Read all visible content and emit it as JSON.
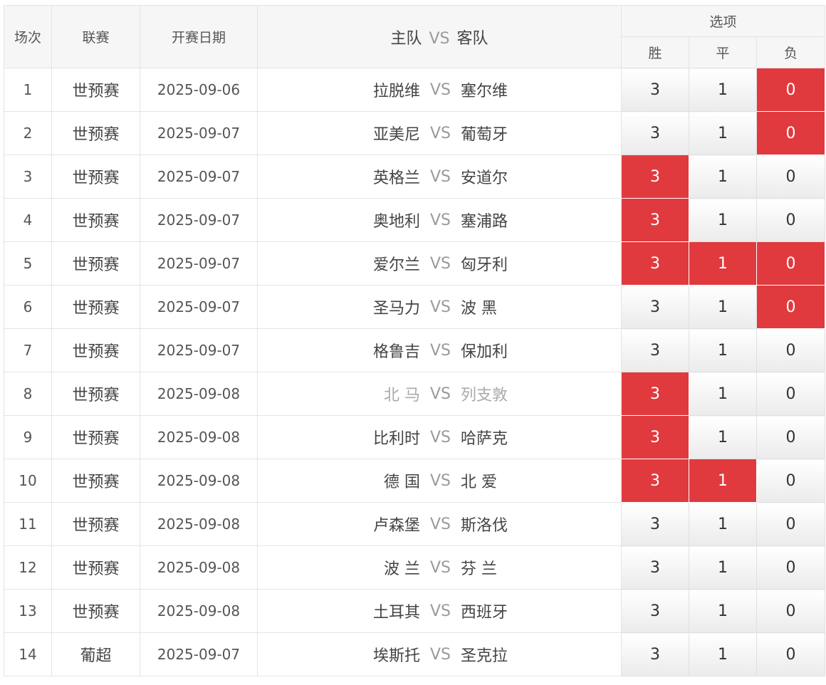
{
  "header": {
    "idx": "场次",
    "league": "联赛",
    "date": "开赛日期",
    "home": "主队",
    "vs": "VS",
    "away": "客队",
    "options": "选项",
    "win": "胜",
    "draw": "平",
    "lose": "负"
  },
  "colors": {
    "selected": "#e03a3e",
    "vs": "#9a9a9a"
  },
  "rows": [
    {
      "idx": "1",
      "league": "世预赛",
      "date": "2025-09-06",
      "home": "拉脱维",
      "vs": "VS",
      "away": "塞尔维",
      "win": "3",
      "draw": "1",
      "lose": "0",
      "sel": [
        false,
        false,
        true
      ],
      "muted": false
    },
    {
      "idx": "2",
      "league": "世预赛",
      "date": "2025-09-07",
      "home": "亚美尼",
      "vs": "VS",
      "away": "葡萄牙",
      "win": "3",
      "draw": "1",
      "lose": "0",
      "sel": [
        false,
        false,
        true
      ],
      "muted": false
    },
    {
      "idx": "3",
      "league": "世预赛",
      "date": "2025-09-07",
      "home": "英格兰",
      "vs": "VS",
      "away": "安道尔",
      "win": "3",
      "draw": "1",
      "lose": "0",
      "sel": [
        true,
        false,
        false
      ],
      "muted": false
    },
    {
      "idx": "4",
      "league": "世预赛",
      "date": "2025-09-07",
      "home": "奥地利",
      "vs": "VS",
      "away": "塞浦路",
      "win": "3",
      "draw": "1",
      "lose": "0",
      "sel": [
        true,
        false,
        false
      ],
      "muted": false
    },
    {
      "idx": "5",
      "league": "世预赛",
      "date": "2025-09-07",
      "home": "爱尔兰",
      "vs": "VS",
      "away": "匈牙利",
      "win": "3",
      "draw": "1",
      "lose": "0",
      "sel": [
        true,
        true,
        true
      ],
      "muted": false
    },
    {
      "idx": "6",
      "league": "世预赛",
      "date": "2025-09-07",
      "home": "圣马力",
      "vs": "VS",
      "away": "波 黑",
      "win": "3",
      "draw": "1",
      "lose": "0",
      "sel": [
        false,
        false,
        true
      ],
      "muted": false
    },
    {
      "idx": "7",
      "league": "世预赛",
      "date": "2025-09-07",
      "home": "格鲁吉",
      "vs": "VS",
      "away": "保加利",
      "win": "3",
      "draw": "1",
      "lose": "0",
      "sel": [
        false,
        false,
        false
      ],
      "muted": false
    },
    {
      "idx": "8",
      "league": "世预赛",
      "date": "2025-09-08",
      "home": "北 马",
      "vs": "VS",
      "away": "列支敦",
      "win": "3",
      "draw": "1",
      "lose": "0",
      "sel": [
        true,
        false,
        false
      ],
      "muted": true
    },
    {
      "idx": "9",
      "league": "世预赛",
      "date": "2025-09-08",
      "home": "比利时",
      "vs": "VS",
      "away": "哈萨克",
      "win": "3",
      "draw": "1",
      "lose": "0",
      "sel": [
        true,
        false,
        false
      ],
      "muted": false
    },
    {
      "idx": "10",
      "league": "世预赛",
      "date": "2025-09-08",
      "home": "德 国",
      "vs": "VS",
      "away": "北 爱",
      "win": "3",
      "draw": "1",
      "lose": "0",
      "sel": [
        true,
        true,
        false
      ],
      "muted": false
    },
    {
      "idx": "11",
      "league": "世预赛",
      "date": "2025-09-08",
      "home": "卢森堡",
      "vs": "VS",
      "away": "斯洛伐",
      "win": "3",
      "draw": "1",
      "lose": "0",
      "sel": [
        false,
        false,
        false
      ],
      "muted": false
    },
    {
      "idx": "12",
      "league": "世预赛",
      "date": "2025-09-08",
      "home": "波 兰",
      "vs": "VS",
      "away": "芬 兰",
      "win": "3",
      "draw": "1",
      "lose": "0",
      "sel": [
        false,
        false,
        false
      ],
      "muted": false
    },
    {
      "idx": "13",
      "league": "世预赛",
      "date": "2025-09-08",
      "home": "土耳其",
      "vs": "VS",
      "away": "西班牙",
      "win": "3",
      "draw": "1",
      "lose": "0",
      "sel": [
        false,
        false,
        false
      ],
      "muted": false
    },
    {
      "idx": "14",
      "league": "葡超",
      "date": "2025-09-07",
      "home": "埃斯托",
      "vs": "VS",
      "away": "圣克拉",
      "win": "3",
      "draw": "1",
      "lose": "0",
      "sel": [
        false,
        false,
        false
      ],
      "muted": false
    }
  ]
}
